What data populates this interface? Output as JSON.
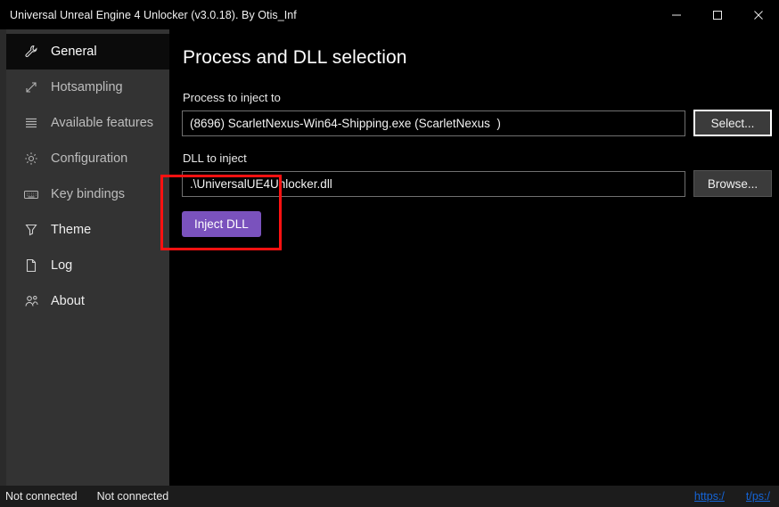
{
  "window": {
    "title": "Universal Unreal Engine 4 Unlocker (v3.0.18). By Otis_Inf",
    "controls": {
      "minimize": "minimize-icon",
      "maximize": "maximize-icon",
      "close": "close-icon"
    }
  },
  "sidebar": {
    "items": [
      {
        "label": "General",
        "icon": "wrench-icon",
        "selected": true,
        "bright": true
      },
      {
        "label": "Hotsampling",
        "icon": "resize-icon",
        "selected": false,
        "bright": false
      },
      {
        "label": "Available features",
        "icon": "list-icon",
        "selected": false,
        "bright": false
      },
      {
        "label": "Configuration",
        "icon": "gear-icon",
        "selected": false,
        "bright": false
      },
      {
        "label": "Key bindings",
        "icon": "keyboard-icon",
        "selected": false,
        "bright": false
      },
      {
        "label": "Theme",
        "icon": "paint-icon",
        "selected": false,
        "bright": true
      },
      {
        "label": "Log",
        "icon": "document-icon",
        "selected": false,
        "bright": true
      },
      {
        "label": "About",
        "icon": "people-icon",
        "selected": false,
        "bright": true
      }
    ]
  },
  "main": {
    "page_title": "Process and DLL selection",
    "process": {
      "label": "Process to inject to",
      "value": "(8696) ScarletNexus-Win64-Shipping.exe (ScarletNexus  )",
      "placeholder": "",
      "button_label": "Select..."
    },
    "dll": {
      "label": "DLL to inject",
      "value": ".\\UniversalUE4Unlocker.dll",
      "placeholder": "",
      "button_label": "Browse..."
    },
    "inject_button_label": "Inject DLL"
  },
  "annotation": {
    "highlight_color": "#ff1111"
  },
  "statusbar": {
    "left_status": "Not connected",
    "right_status": "Not connected",
    "link_1": "https:/",
    "link_2": "t/ps:/",
    "link_color": "#1565d8"
  },
  "colors": {
    "accent": "#7a52bd",
    "sidebar_bg": "#333333",
    "panel_bg": "#000000",
    "statusbar_bg": "#1c1c1c"
  }
}
